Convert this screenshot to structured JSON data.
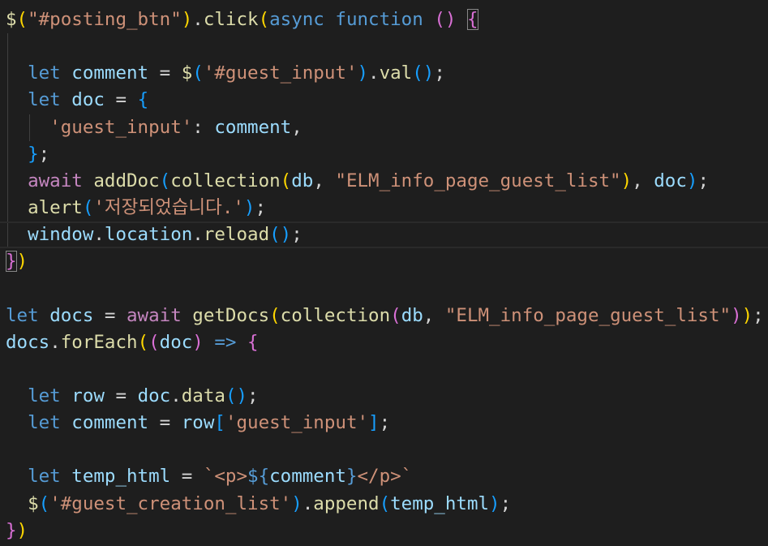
{
  "editor": {
    "theme": "dark",
    "background": "#1e1e1e",
    "highlighted_line_index": 8,
    "lines": [
      {
        "indent_guides": 0,
        "tokens": [
          {
            "t": "$",
            "c": "#dcdcaa"
          },
          {
            "t": "(",
            "c": "#ffd700"
          },
          {
            "t": "\"#posting_btn\"",
            "c": "#ce9178"
          },
          {
            "t": ")",
            "c": "#ffd700"
          },
          {
            "t": ".",
            "c": "#d4d4d4"
          },
          {
            "t": "click",
            "c": "#dcdcaa"
          },
          {
            "t": "(",
            "c": "#ffd700"
          },
          {
            "t": "async",
            "c": "#569cd6"
          },
          {
            "t": " ",
            "c": "#d4d4d4"
          },
          {
            "t": "function",
            "c": "#569cd6"
          },
          {
            "t": " ",
            "c": "#d4d4d4"
          },
          {
            "t": "()",
            "c": "#da70d6"
          },
          {
            "t": " ",
            "c": "#d4d4d4"
          },
          {
            "t": "{",
            "c": "#da70d6",
            "box": true
          }
        ]
      },
      {
        "indent_guides": 1,
        "tokens": []
      },
      {
        "indent_guides": 1,
        "tokens": [
          {
            "t": "  ",
            "c": "#d4d4d4"
          },
          {
            "t": "let",
            "c": "#569cd6"
          },
          {
            "t": " ",
            "c": "#d4d4d4"
          },
          {
            "t": "comment",
            "c": "#9cdcfe"
          },
          {
            "t": " = ",
            "c": "#d4d4d4"
          },
          {
            "t": "$",
            "c": "#dcdcaa"
          },
          {
            "t": "(",
            "c": "#179fff"
          },
          {
            "t": "'#guest_input'",
            "c": "#ce9178"
          },
          {
            "t": ")",
            "c": "#179fff"
          },
          {
            "t": ".",
            "c": "#d4d4d4"
          },
          {
            "t": "val",
            "c": "#dcdcaa"
          },
          {
            "t": "()",
            "c": "#179fff"
          },
          {
            "t": ";",
            "c": "#d4d4d4"
          }
        ]
      },
      {
        "indent_guides": 1,
        "tokens": [
          {
            "t": "  ",
            "c": "#d4d4d4"
          },
          {
            "t": "let",
            "c": "#569cd6"
          },
          {
            "t": " ",
            "c": "#d4d4d4"
          },
          {
            "t": "doc",
            "c": "#9cdcfe"
          },
          {
            "t": " = ",
            "c": "#d4d4d4"
          },
          {
            "t": "{",
            "c": "#179fff"
          }
        ]
      },
      {
        "indent_guides": 2,
        "tokens": [
          {
            "t": "    ",
            "c": "#d4d4d4"
          },
          {
            "t": "'guest_input'",
            "c": "#ce9178"
          },
          {
            "t": ": ",
            "c": "#d4d4d4"
          },
          {
            "t": "comment",
            "c": "#9cdcfe"
          },
          {
            "t": ",",
            "c": "#d4d4d4"
          }
        ]
      },
      {
        "indent_guides": 1,
        "tokens": [
          {
            "t": "  ",
            "c": "#d4d4d4"
          },
          {
            "t": "}",
            "c": "#179fff"
          },
          {
            "t": ";",
            "c": "#d4d4d4"
          }
        ]
      },
      {
        "indent_guides": 1,
        "tokens": [
          {
            "t": "  ",
            "c": "#d4d4d4"
          },
          {
            "t": "await",
            "c": "#c586c0"
          },
          {
            "t": " ",
            "c": "#d4d4d4"
          },
          {
            "t": "addDoc",
            "c": "#dcdcaa"
          },
          {
            "t": "(",
            "c": "#179fff"
          },
          {
            "t": "collection",
            "c": "#dcdcaa"
          },
          {
            "t": "(",
            "c": "#ffd700"
          },
          {
            "t": "db",
            "c": "#9cdcfe"
          },
          {
            "t": ", ",
            "c": "#d4d4d4"
          },
          {
            "t": "\"ELM_info_page_guest_list\"",
            "c": "#ce9178"
          },
          {
            "t": ")",
            "c": "#ffd700"
          },
          {
            "t": ", ",
            "c": "#d4d4d4"
          },
          {
            "t": "doc",
            "c": "#9cdcfe"
          },
          {
            "t": ")",
            "c": "#179fff"
          },
          {
            "t": ";",
            "c": "#d4d4d4"
          }
        ]
      },
      {
        "indent_guides": 1,
        "tokens": [
          {
            "t": "  ",
            "c": "#d4d4d4"
          },
          {
            "t": "alert",
            "c": "#dcdcaa"
          },
          {
            "t": "(",
            "c": "#179fff"
          },
          {
            "t": "'저장되었습니다.'",
            "c": "#ce9178"
          },
          {
            "t": ")",
            "c": "#179fff"
          },
          {
            "t": ";",
            "c": "#d4d4d4"
          }
        ]
      },
      {
        "indent_guides": 1,
        "tokens": [
          {
            "t": "  ",
            "c": "#d4d4d4"
          },
          {
            "t": "window",
            "c": "#9cdcfe"
          },
          {
            "t": ".",
            "c": "#d4d4d4"
          },
          {
            "t": "location",
            "c": "#9cdcfe"
          },
          {
            "t": ".",
            "c": "#d4d4d4"
          },
          {
            "t": "reload",
            "c": "#dcdcaa"
          },
          {
            "t": "()",
            "c": "#179fff"
          },
          {
            "t": ";",
            "c": "#d4d4d4"
          }
        ]
      },
      {
        "indent_guides": 0,
        "tokens": [
          {
            "t": "}",
            "c": "#da70d6",
            "box": true
          },
          {
            "t": ")",
            "c": "#ffd700"
          }
        ]
      },
      {
        "indent_guides": 0,
        "tokens": []
      },
      {
        "indent_guides": 0,
        "tokens": [
          {
            "t": "let",
            "c": "#569cd6"
          },
          {
            "t": " ",
            "c": "#d4d4d4"
          },
          {
            "t": "docs",
            "c": "#9cdcfe"
          },
          {
            "t": " = ",
            "c": "#d4d4d4"
          },
          {
            "t": "await",
            "c": "#c586c0"
          },
          {
            "t": " ",
            "c": "#d4d4d4"
          },
          {
            "t": "getDocs",
            "c": "#dcdcaa"
          },
          {
            "t": "(",
            "c": "#ffd700"
          },
          {
            "t": "collection",
            "c": "#dcdcaa"
          },
          {
            "t": "(",
            "c": "#da70d6"
          },
          {
            "t": "db",
            "c": "#9cdcfe"
          },
          {
            "t": ", ",
            "c": "#d4d4d4"
          },
          {
            "t": "\"ELM_info_page_guest_list\"",
            "c": "#ce9178"
          },
          {
            "t": ")",
            "c": "#da70d6"
          },
          {
            "t": ")",
            "c": "#ffd700"
          },
          {
            "t": ";",
            "c": "#d4d4d4"
          }
        ]
      },
      {
        "indent_guides": 0,
        "tokens": [
          {
            "t": "docs",
            "c": "#9cdcfe"
          },
          {
            "t": ".",
            "c": "#d4d4d4"
          },
          {
            "t": "forEach",
            "c": "#dcdcaa"
          },
          {
            "t": "(",
            "c": "#ffd700"
          },
          {
            "t": "(",
            "c": "#da70d6"
          },
          {
            "t": "doc",
            "c": "#9cdcfe"
          },
          {
            "t": ")",
            "c": "#da70d6"
          },
          {
            "t": " ",
            "c": "#d4d4d4"
          },
          {
            "t": "=>",
            "c": "#569cd6"
          },
          {
            "t": " ",
            "c": "#d4d4d4"
          },
          {
            "t": "{",
            "c": "#da70d6"
          }
        ]
      },
      {
        "indent_guides": 0,
        "tokens": []
      },
      {
        "indent_guides": 0,
        "tokens": [
          {
            "t": "  ",
            "c": "#d4d4d4"
          },
          {
            "t": "let",
            "c": "#569cd6"
          },
          {
            "t": " ",
            "c": "#d4d4d4"
          },
          {
            "t": "row",
            "c": "#9cdcfe"
          },
          {
            "t": " = ",
            "c": "#d4d4d4"
          },
          {
            "t": "doc",
            "c": "#9cdcfe"
          },
          {
            "t": ".",
            "c": "#d4d4d4"
          },
          {
            "t": "data",
            "c": "#dcdcaa"
          },
          {
            "t": "()",
            "c": "#179fff"
          },
          {
            "t": ";",
            "c": "#d4d4d4"
          }
        ]
      },
      {
        "indent_guides": 0,
        "tokens": [
          {
            "t": "  ",
            "c": "#d4d4d4"
          },
          {
            "t": "let",
            "c": "#569cd6"
          },
          {
            "t": " ",
            "c": "#d4d4d4"
          },
          {
            "t": "comment",
            "c": "#9cdcfe"
          },
          {
            "t": " = ",
            "c": "#d4d4d4"
          },
          {
            "t": "row",
            "c": "#9cdcfe"
          },
          {
            "t": "[",
            "c": "#179fff"
          },
          {
            "t": "'guest_input'",
            "c": "#ce9178"
          },
          {
            "t": "]",
            "c": "#179fff"
          },
          {
            "t": ";",
            "c": "#d4d4d4"
          }
        ]
      },
      {
        "indent_guides": 0,
        "tokens": []
      },
      {
        "indent_guides": 0,
        "tokens": [
          {
            "t": "  ",
            "c": "#d4d4d4"
          },
          {
            "t": "let",
            "c": "#569cd6"
          },
          {
            "t": " ",
            "c": "#d4d4d4"
          },
          {
            "t": "temp_html",
            "c": "#9cdcfe"
          },
          {
            "t": " = ",
            "c": "#d4d4d4"
          },
          {
            "t": "`<p>",
            "c": "#ce9178"
          },
          {
            "t": "${",
            "c": "#569cd6"
          },
          {
            "t": "comment",
            "c": "#9cdcfe"
          },
          {
            "t": "}",
            "c": "#569cd6"
          },
          {
            "t": "</p>`",
            "c": "#ce9178"
          }
        ]
      },
      {
        "indent_guides": 0,
        "tokens": [
          {
            "t": "  ",
            "c": "#d4d4d4"
          },
          {
            "t": "$",
            "c": "#dcdcaa"
          },
          {
            "t": "(",
            "c": "#179fff"
          },
          {
            "t": "'#guest_creation_list'",
            "c": "#ce9178"
          },
          {
            "t": ")",
            "c": "#179fff"
          },
          {
            "t": ".",
            "c": "#d4d4d4"
          },
          {
            "t": "append",
            "c": "#dcdcaa"
          },
          {
            "t": "(",
            "c": "#179fff"
          },
          {
            "t": "temp_html",
            "c": "#9cdcfe"
          },
          {
            "t": ")",
            "c": "#179fff"
          },
          {
            "t": ";",
            "c": "#d4d4d4"
          }
        ]
      },
      {
        "indent_guides": 0,
        "tokens": [
          {
            "t": "}",
            "c": "#da70d6"
          },
          {
            "t": ")",
            "c": "#ffd700"
          }
        ]
      }
    ]
  }
}
